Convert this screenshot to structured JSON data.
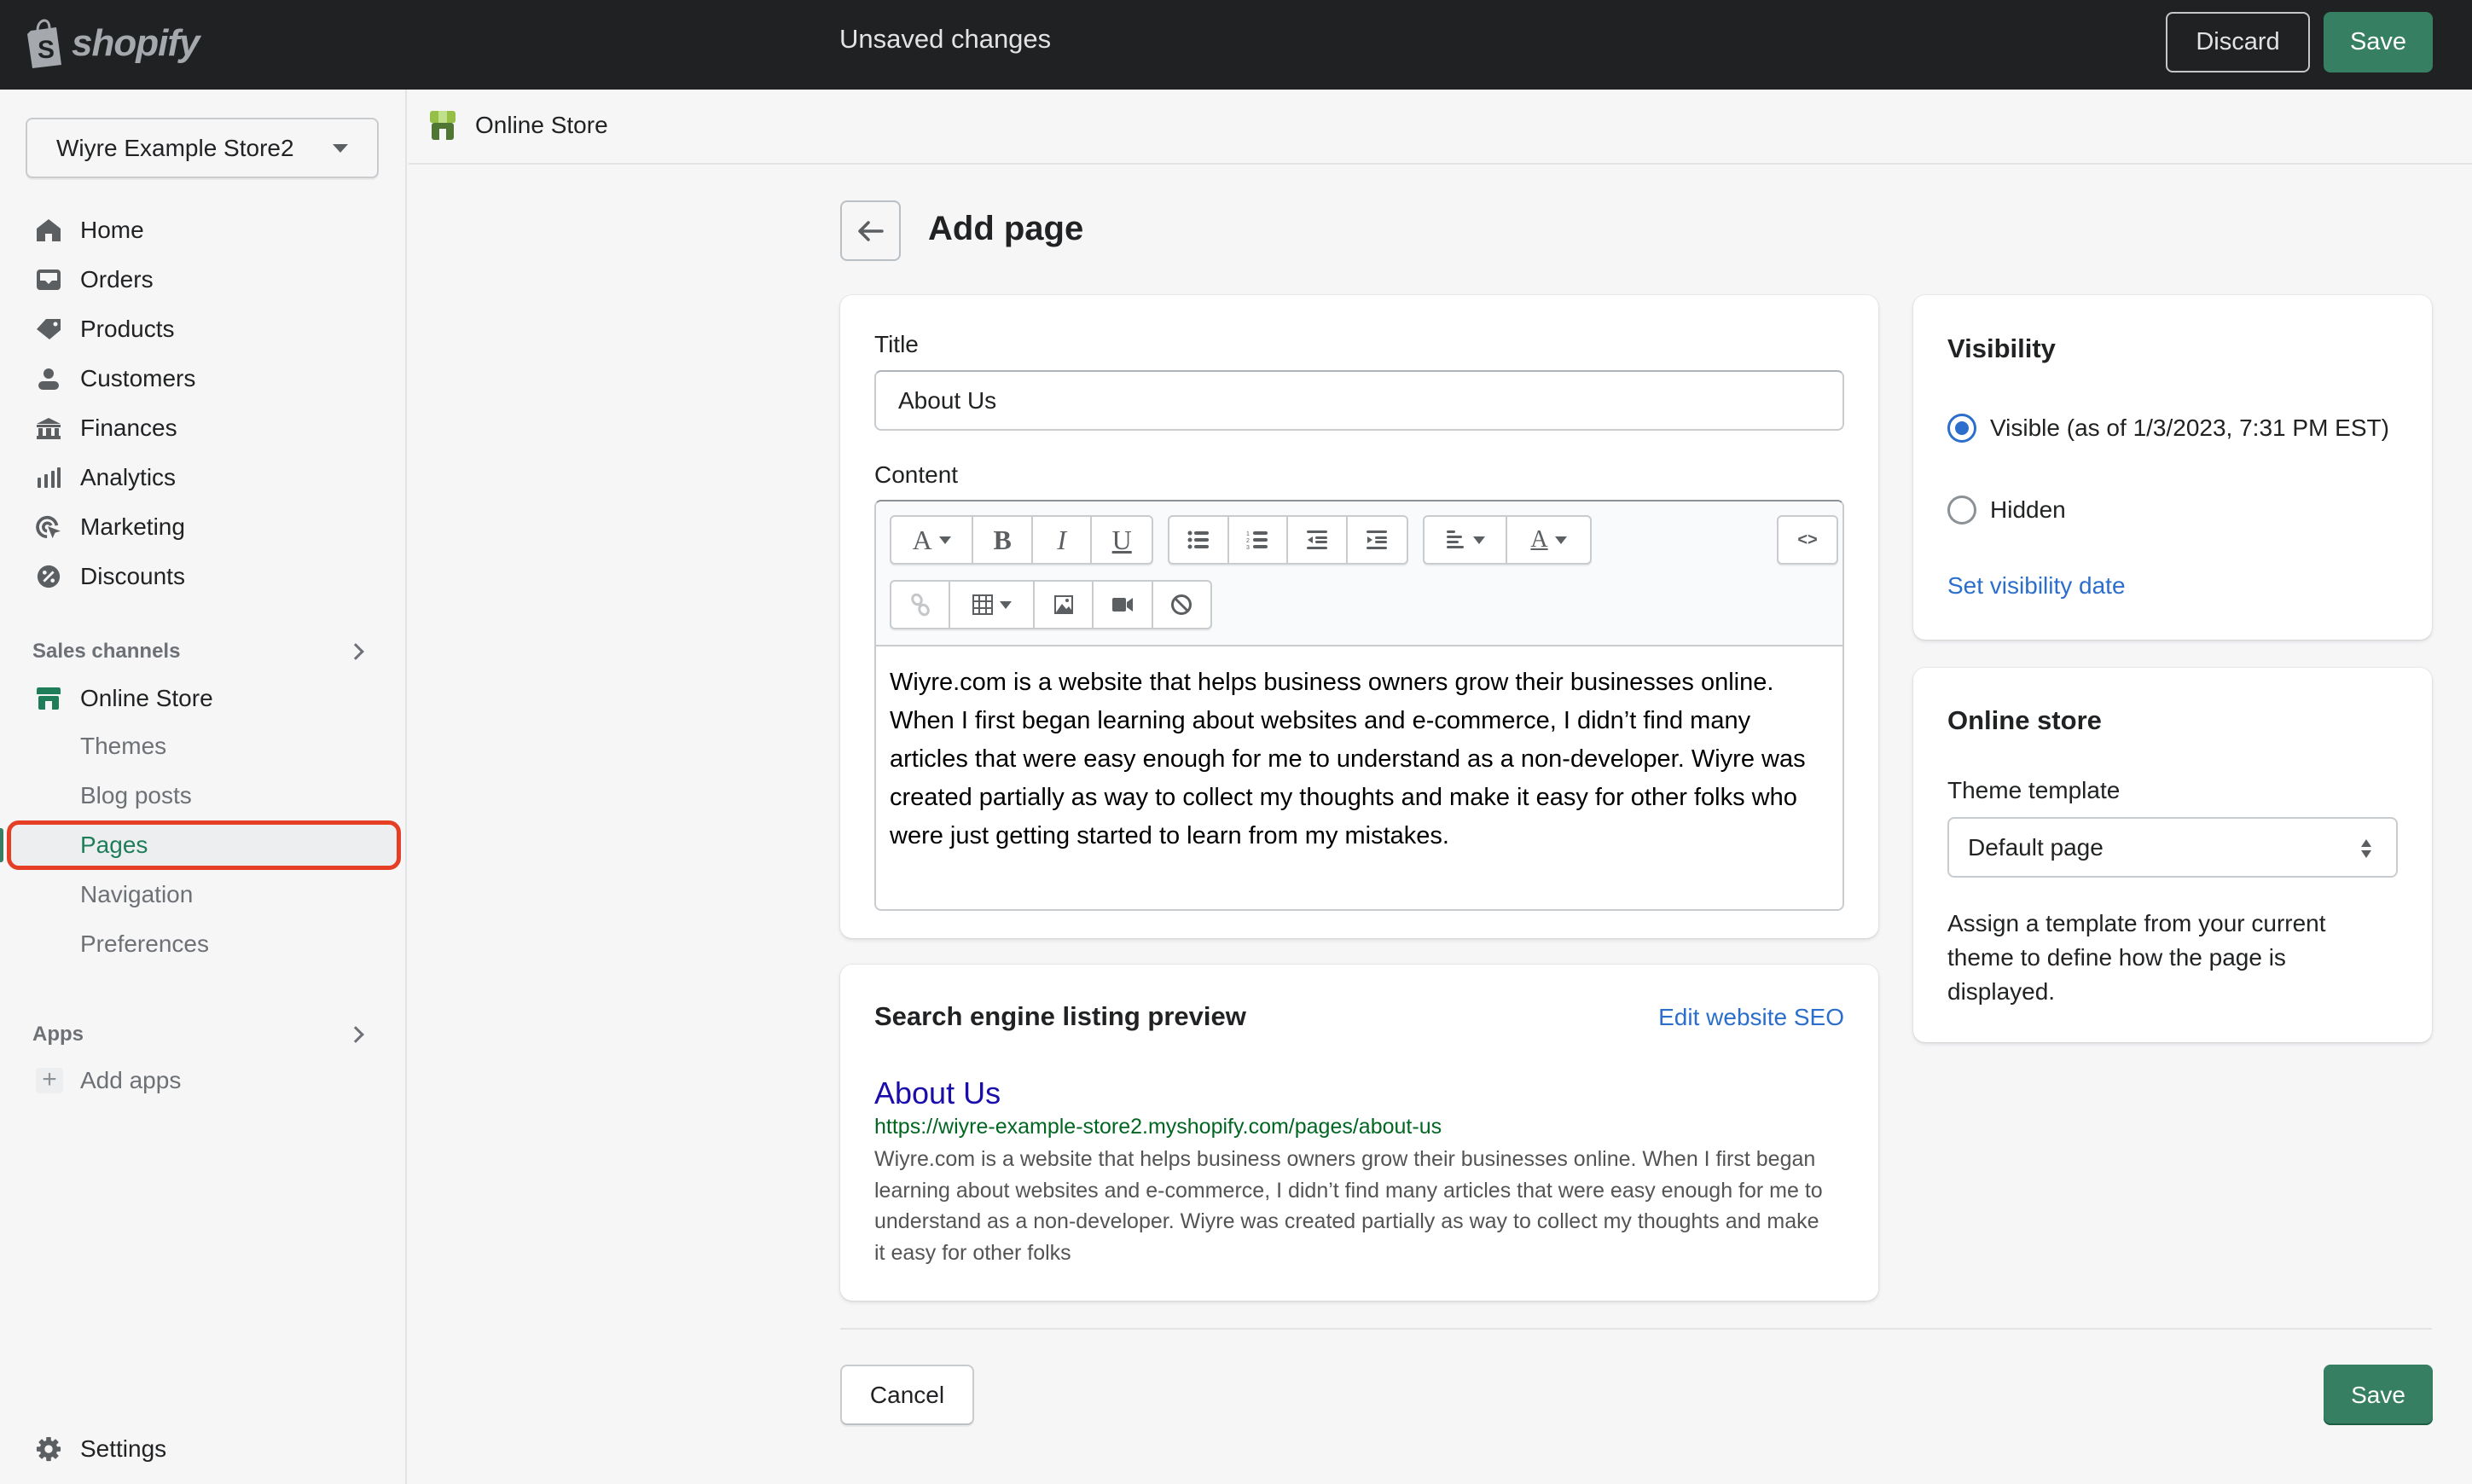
{
  "topbar": {
    "brand": "shopify",
    "status": "Unsaved changes",
    "discard_label": "Discard",
    "save_label": "Save"
  },
  "sidebar": {
    "store_name": "Wiyre Example Store2",
    "items": [
      {
        "label": "Home",
        "icon": "home-icon"
      },
      {
        "label": "Orders",
        "icon": "inbox-icon"
      },
      {
        "label": "Products",
        "icon": "tag-icon"
      },
      {
        "label": "Customers",
        "icon": "person-icon"
      },
      {
        "label": "Finances",
        "icon": "bank-icon"
      },
      {
        "label": "Analytics",
        "icon": "bar-chart-icon"
      },
      {
        "label": "Marketing",
        "icon": "target-cursor-icon"
      },
      {
        "label": "Discounts",
        "icon": "discount-badge-icon"
      }
    ],
    "sales_channels_label": "Sales channels",
    "online_store": {
      "label": "Online Store",
      "icon": "storefront-icon",
      "subitems": [
        {
          "label": "Themes"
        },
        {
          "label": "Blog posts"
        },
        {
          "label": "Pages",
          "active": true
        },
        {
          "label": "Navigation"
        },
        {
          "label": "Preferences"
        }
      ]
    },
    "apps_label": "Apps",
    "add_apps_label": "Add apps",
    "settings_label": "Settings"
  },
  "breadcrumb": {
    "label": "Online Store"
  },
  "page": {
    "title": "Add page",
    "title_field_label": "Title",
    "title_value": "About Us",
    "content_label": "Content",
    "content_text": "Wiyre.com is a website that helps business owners grow their businesses online. When I first began learning about websites and e-commerce, I didn’t find many articles that were easy enough for me to understand as a non-developer. Wiyre was created partially as way to collect my thoughts and make it easy for other folks who were just getting started to learn from my mistakes.",
    "toolbar": {
      "font": "A",
      "bold": "B",
      "italic": "I",
      "underline": "U",
      "color": "A",
      "html": "<>"
    }
  },
  "seo": {
    "heading": "Search engine listing preview",
    "edit_label": "Edit website SEO",
    "preview_title": "About Us",
    "preview_url": "https://wiyre-example-store2.myshopify.com/pages/about-us",
    "preview_description": "Wiyre.com is a website that helps business owners grow their businesses online. When I first began learning about websites and e-commerce, I didn’t find many articles that were easy enough for me to understand as a non-developer. Wiyre was created partially as way to collect my thoughts and make it easy for other folks"
  },
  "visibility": {
    "heading": "Visibility",
    "options": [
      {
        "label": "Visible (as of 1/3/2023, 7:31 PM EST)",
        "checked": true
      },
      {
        "label": "Hidden",
        "checked": false
      }
    ],
    "set_date_label": "Set visibility date"
  },
  "online_store_card": {
    "heading": "Online store",
    "template_label": "Theme template",
    "template_value": "Default page",
    "helper": "Assign a template from your current theme to define how the page is displayed."
  },
  "footer": {
    "cancel_label": "Cancel",
    "save_label": "Save"
  },
  "colors": {
    "primary": "#367f62",
    "link": "#2c6ecb",
    "highlight": "#e63e25",
    "topbar": "#202123"
  }
}
